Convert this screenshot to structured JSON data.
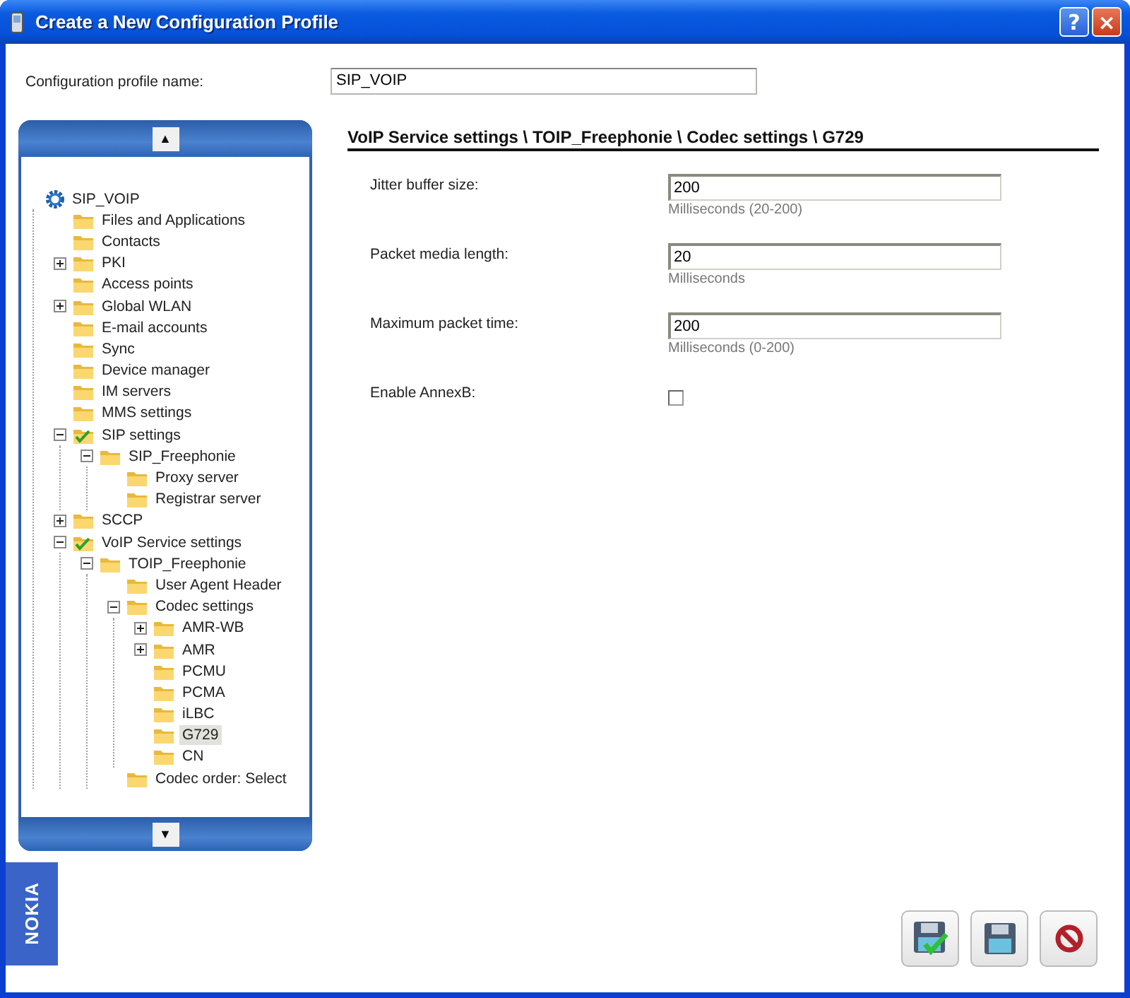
{
  "window": {
    "title": "Create a New Configuration Profile",
    "help_button": "?",
    "close_button": "×"
  },
  "profile_name": {
    "label": "Configuration profile name:",
    "value": "SIP_VOIP"
  },
  "tree": {
    "up_arrow": "▲",
    "down_arrow": "▼",
    "items": [
      {
        "label": "SIP_VOIP",
        "kind": "root",
        "selected": false,
        "children": [
          {
            "label": "Files and Applications",
            "kind": "folder",
            "selected": false
          },
          {
            "label": "Contacts",
            "kind": "folder",
            "selected": false
          },
          {
            "label": "PKI",
            "kind": "folder",
            "selected": false,
            "expanded": false
          },
          {
            "label": "Access points",
            "kind": "folder",
            "selected": false
          },
          {
            "label": "Global WLAN",
            "kind": "folder",
            "selected": false,
            "expanded": false
          },
          {
            "label": "E-mail accounts",
            "kind": "folder",
            "selected": false
          },
          {
            "label": "Sync",
            "kind": "folder",
            "selected": false
          },
          {
            "label": "Device manager",
            "kind": "folder",
            "selected": false
          },
          {
            "label": "IM servers",
            "kind": "folder",
            "selected": false
          },
          {
            "label": "MMS settings",
            "kind": "folder",
            "selected": false
          },
          {
            "label": "SIP settings",
            "kind": "configured",
            "selected": false,
            "expanded": true,
            "children": [
              {
                "label": "SIP_Freephonie",
                "kind": "folder",
                "selected": false,
                "expanded": true,
                "children": [
                  {
                    "label": "Proxy server",
                    "kind": "folder",
                    "selected": false
                  },
                  {
                    "label": "Registrar server",
                    "kind": "folder",
                    "selected": false
                  }
                ]
              }
            ]
          },
          {
            "label": "SCCP",
            "kind": "folder",
            "selected": false,
            "expanded": false
          },
          {
            "label": "VoIP Service settings",
            "kind": "configured",
            "selected": false,
            "expanded": true,
            "children": [
              {
                "label": "TOIP_Freephonie",
                "kind": "folder",
                "selected": false,
                "expanded": true,
                "children": [
                  {
                    "label": "User Agent Header",
                    "kind": "folder",
                    "selected": false
                  },
                  {
                    "label": "Codec settings",
                    "kind": "folder",
                    "selected": false,
                    "expanded": true,
                    "children": [
                      {
                        "label": "AMR-WB",
                        "kind": "folder",
                        "selected": false,
                        "expanded": false
                      },
                      {
                        "label": "AMR",
                        "kind": "folder",
                        "selected": false,
                        "expanded": false
                      },
                      {
                        "label": "PCMU",
                        "kind": "folder",
                        "selected": false
                      },
                      {
                        "label": "PCMA",
                        "kind": "folder",
                        "selected": false
                      },
                      {
                        "label": "iLBC",
                        "kind": "folder",
                        "selected": false
                      },
                      {
                        "label": "G729",
                        "kind": "folder",
                        "selected": true
                      },
                      {
                        "label": "CN",
                        "kind": "folder",
                        "selected": false
                      }
                    ]
                  },
                  {
                    "label": "Codec order: Select",
                    "kind": "folder",
                    "selected": false
                  }
                ]
              }
            ]
          }
        ]
      }
    ]
  },
  "settings": {
    "heading": "VoIP Service settings \\ TOIP_Freephonie \\ Codec settings \\ G729",
    "fields": [
      {
        "kind": "text",
        "label": "Jitter buffer size:",
        "value": "200",
        "hint": "Milliseconds (20-200)"
      },
      {
        "kind": "text",
        "label": "Packet media length:",
        "value": "20",
        "hint": "Milliseconds"
      },
      {
        "kind": "text",
        "label": "Maximum packet time:",
        "value": "200",
        "hint": "Milliseconds (0-200)"
      },
      {
        "kind": "checkbox",
        "label": "Enable AnnexB:",
        "checked": false
      }
    ]
  },
  "brand": "NOKIA",
  "actions": [
    {
      "kind": "save-and-close"
    },
    {
      "kind": "save"
    },
    {
      "kind": "cancel"
    }
  ]
}
